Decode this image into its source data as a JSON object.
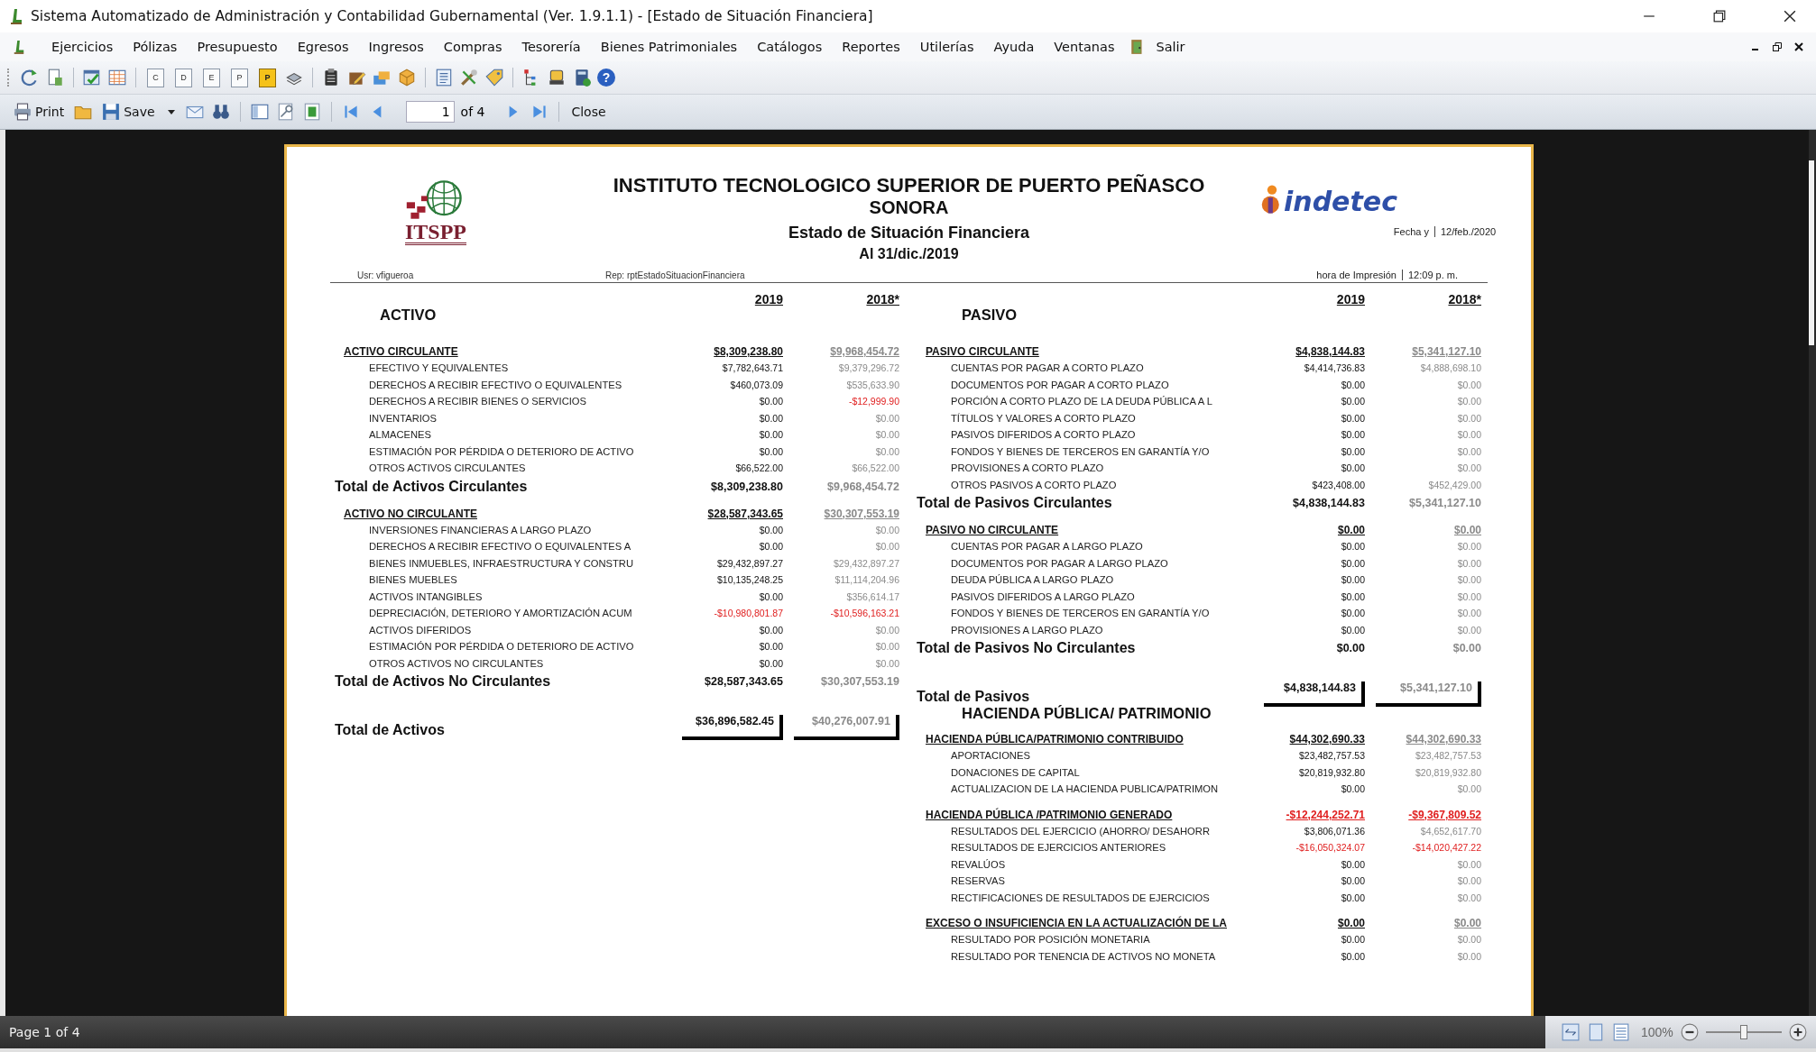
{
  "window": {
    "title": "Sistema Automatizado de Administración y Contabilidad Gubernamental  (Ver. 1.9.1.1) - [Estado de Situación Financiera]"
  },
  "menu": [
    "Ejercicios",
    "Pólizas",
    "Presupuesto",
    "Egresos",
    "Ingresos",
    "Compras",
    "Tesorería",
    "Bienes Patrimoniales",
    "Catálogos",
    "Reportes",
    "Utilerías",
    "Ayuda",
    "Ventanas",
    "Salir"
  ],
  "toolbar": {
    "letter_buttons": [
      {
        "letter": "C",
        "kind": "plain"
      },
      {
        "letter": "D",
        "kind": "plain"
      },
      {
        "letter": "E",
        "kind": "plain"
      },
      {
        "letter": "P",
        "kind": "plain"
      },
      {
        "letter": "P",
        "kind": "highlight"
      }
    ],
    "help_glyph": "?"
  },
  "viewer_toolbar": {
    "print": "Print",
    "save": "Save",
    "page": "1",
    "page_total": "of 4",
    "close": "Close"
  },
  "report": {
    "logo_text": "ITSPP",
    "title": "INSTITUTO TECNOLOGICO SUPERIOR DE PUERTO PEÑASCO",
    "subtitle": "SONORA",
    "report_name": "Estado de Situación Financiera",
    "date_line": "Al 31/dic./2019",
    "brand": "indetec",
    "fecha_label": "Fecha y",
    "fecha": "12/feb./2020",
    "hora_label": "hora de Impresión",
    "hora": "12:09 p. m.",
    "user": "Usr: vfigueroa",
    "rep": "Rep: rptEstadoSituacionFinanciera",
    "left": {
      "title": "ACTIVO",
      "columns": [
        "2019",
        "2018*"
      ],
      "sections": [
        {
          "heading": "ACTIVO CIRCULANTE",
          "current": "$8,309,238.80",
          "previous": "$9,968,454.72",
          "rows": [
            {
              "label": "EFECTIVO Y EQUIVALENTES",
              "current": "$7,782,643.71",
              "previous": "$9,379,296.72"
            },
            {
              "label": "DERECHOS A RECIBIR EFECTIVO O EQUIVALENTES",
              "current": "$460,073.09",
              "previous": "$535,633.90"
            },
            {
              "label": "DERECHOS A RECIBIR BIENES O SERVICIOS",
              "current": "$0.00",
              "previous": "-$12,999.90",
              "negative_previous": true
            },
            {
              "label": "INVENTARIOS",
              "current": "$0.00",
              "previous": "$0.00"
            },
            {
              "label": "ALMACENES",
              "current": "$0.00",
              "previous": "$0.00"
            },
            {
              "label": "ESTIMACIÓN POR PÉRDIDA O DETERIORO DE ACTIVO",
              "current": "$0.00",
              "previous": "$0.00"
            },
            {
              "label": "OTROS ACTIVOS CIRCULANTES",
              "current": "$66,522.00",
              "previous": "$66,522.00"
            }
          ],
          "total": {
            "label": "Total de Activos Circulantes",
            "current": "$8,309,238.80",
            "previous": "$9,968,454.72"
          }
        },
        {
          "heading": "ACTIVO NO CIRCULANTE",
          "current": "$28,587,343.65",
          "previous": "$30,307,553.19",
          "rows": [
            {
              "label": "INVERSIONES FINANCIERAS A LARGO PLAZO",
              "current": "$0.00",
              "previous": "$0.00"
            },
            {
              "label": "DERECHOS A RECIBIR EFECTIVO O EQUIVALENTES A",
              "current": "$0.00",
              "previous": "$0.00"
            },
            {
              "label": "BIENES INMUEBLES, INFRAESTRUCTURA Y CONSTRU",
              "current": "$29,432,897.27",
              "previous": "$29,432,897.27"
            },
            {
              "label": "BIENES MUEBLES",
              "current": "$10,135,248.25",
              "previous": "$11,114,204.96"
            },
            {
              "label": "ACTIVOS INTANGIBLES",
              "current": "$0.00",
              "previous": "$356,614.17"
            },
            {
              "label": "DEPRECIACIÓN, DETERIORO Y AMORTIZACIÓN ACUM",
              "current": "-$10,980,801.87",
              "previous": "-$10,596,163.21",
              "negative_current": true,
              "negative_previous": true
            },
            {
              "label": "ACTIVOS DIFERIDOS",
              "current": "$0.00",
              "previous": "$0.00"
            },
            {
              "label": "ESTIMACIÓN POR PÉRDIDA O DETERIORO DE ACTIVO",
              "current": "$0.00",
              "previous": "$0.00"
            },
            {
              "label": "OTROS ACTIVOS NO CIRCULANTES",
              "current": "$0.00",
              "previous": "$0.00"
            }
          ],
          "total": {
            "label": "Total de Activos No Circulantes",
            "current": "$28,587,343.65",
            "previous": "$30,307,553.19"
          }
        }
      ],
      "grand_total": {
        "label": "Total de Activos",
        "current": "$36,896,582.45",
        "previous": "$40,276,007.91"
      }
    },
    "right": {
      "title": "PASIVO",
      "columns": [
        "2019",
        "2018*"
      ],
      "sections": [
        {
          "heading": "PASIVO CIRCULANTE",
          "current": "$4,838,144.83",
          "previous": "$5,341,127.10",
          "rows": [
            {
              "label": "CUENTAS POR PAGAR A CORTO PLAZO",
              "current": "$4,414,736.83",
              "previous": "$4,888,698.10"
            },
            {
              "label": "DOCUMENTOS POR PAGAR A CORTO PLAZO",
              "current": "$0.00",
              "previous": "$0.00"
            },
            {
              "label": "PORCIÓN A CORTO PLAZO DE LA DEUDA PÚBLICA A L",
              "current": "$0.00",
              "previous": "$0.00"
            },
            {
              "label": "TÍTULOS Y VALORES A CORTO PLAZO",
              "current": "$0.00",
              "previous": "$0.00"
            },
            {
              "label": "PASIVOS DIFERIDOS A CORTO PLAZO",
              "current": "$0.00",
              "previous": "$0.00"
            },
            {
              "label": "FONDOS Y BIENES DE TERCEROS EN  GARANTÍA Y/O",
              "current": "$0.00",
              "previous": "$0.00"
            },
            {
              "label": "PROVISIONES A CORTO PLAZO",
              "current": "$0.00",
              "previous": "$0.00"
            },
            {
              "label": "OTROS PASIVOS A CORTO PLAZO",
              "current": "$423,408.00",
              "previous": "$452,429.00"
            }
          ],
          "total": {
            "label": "Total de Pasivos Circulantes",
            "current": "$4,838,144.83",
            "previous": "$5,341,127.10"
          }
        },
        {
          "heading": "PASIVO NO CIRCULANTE",
          "current": "$0.00",
          "previous": "$0.00",
          "rows": [
            {
              "label": "CUENTAS POR PAGAR A LARGO PLAZO",
              "current": "$0.00",
              "previous": "$0.00"
            },
            {
              "label": "DOCUMENTOS POR PAGAR A LARGO PLAZO",
              "current": "$0.00",
              "previous": "$0.00"
            },
            {
              "label": "DEUDA PÚBLICA A LARGO PLAZO",
              "current": "$0.00",
              "previous": "$0.00"
            },
            {
              "label": "PASIVOS DIFERIDOS A LARGO PLAZO",
              "current": "$0.00",
              "previous": "$0.00"
            },
            {
              "label": "FONDOS Y BIENES DE TERCEROS EN  GARANTÍA Y/O",
              "current": "$0.00",
              "previous": "$0.00"
            },
            {
              "label": "PROVISIONES A LARGO PLAZO",
              "current": "$0.00",
              "previous": "$0.00"
            }
          ],
          "total": {
            "label": "Total de Pasivos No Circulantes",
            "current": "$0.00",
            "previous": "$0.00"
          }
        }
      ],
      "grand_total": {
        "label": "Total de Pasivos",
        "current": "$4,838,144.83",
        "previous": "$5,341,127.10"
      },
      "equity_title": "HACIENDA PÚBLICA/ PATRIMONIO",
      "equity_sections": [
        {
          "heading": "HACIENDA PÚBLICA/PATRIMONIO CONTRIBUIDO",
          "current": "$44,302,690.33",
          "previous": "$44,302,690.33",
          "rows": [
            {
              "label": "APORTACIONES",
              "current": "$23,482,757.53",
              "previous": "$23,482,757.53"
            },
            {
              "label": "DONACIONES DE CAPITAL",
              "current": "$20,819,932.80",
              "previous": "$20,819,932.80"
            },
            {
              "label": "ACTUALIZACION DE LA HACIENDA PUBLICA/PATRIMON",
              "current": "$0.00",
              "previous": "$0.00"
            }
          ]
        },
        {
          "heading": "HACIENDA PÚBLICA /PATRIMONIO GENERADO",
          "current": "-$12,244,252.71",
          "previous": "-$9,367,809.52",
          "negative_current": true,
          "negative_previous": true,
          "rows": [
            {
              "label": "RESULTADOS DEL EJERCICIO (AHORRO/ DESAHORR",
              "current": "$3,806,071.36",
              "previous": "$4,652,617.70"
            },
            {
              "label": "RESULTADOS DE EJERCICIOS ANTERIORES",
              "current": "-$16,050,324.07",
              "previous": "-$14,020,427.22",
              "negative_current": true,
              "negative_previous": true
            },
            {
              "label": "REVALÚOS",
              "current": "$0.00",
              "previous": "$0.00"
            },
            {
              "label": "RESERVAS",
              "current": "$0.00",
              "previous": "$0.00"
            },
            {
              "label": "RECTIFICACIONES DE RESULTADOS DE EJERCICIOS",
              "current": "$0.00",
              "previous": "$0.00"
            }
          ]
        },
        {
          "heading": "EXCESO O INSUFICIENCIA EN LA ACTUALIZACIÓN DE LA",
          "current": "$0.00",
          "previous": "$0.00",
          "rows": [
            {
              "label": "RESULTADO POR POSICIÓN MONETARIA",
              "current": "$0.00",
              "previous": "$0.00"
            },
            {
              "label": "RESULTADO POR TENENCIA DE ACTIVOS NO MONETA",
              "current": "$0.00",
              "previous": "$0.00"
            }
          ]
        }
      ]
    }
  },
  "status_bar": {
    "page_info": "Page 1 of 4",
    "zoom": {
      "label": "100%",
      "level": 0.5
    }
  }
}
